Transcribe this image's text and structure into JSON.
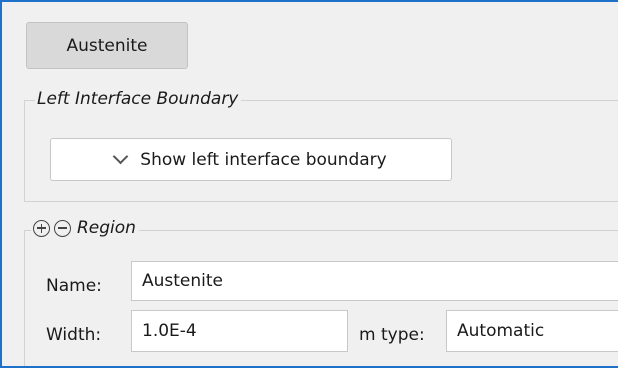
{
  "material_tab": {
    "label": "Austenite"
  },
  "left_interface_boundary": {
    "legend": "Left Interface Boundary",
    "toggle_button_label": "Show left interface boundary"
  },
  "region": {
    "legend": "Region",
    "add_icon": "circle-plus-icon",
    "remove_icon": "circle-minus-icon",
    "name_label": "Name:",
    "name_value": "Austenite",
    "width_label": "Width:",
    "width_value": "1.0E-4",
    "type_label": "m type:",
    "type_value": "Automatic"
  },
  "colors": {
    "window_border": "#1e70c8",
    "background": "#f0f0f0",
    "tab_button": "#d9d9d9",
    "input_background": "#ffffff"
  }
}
